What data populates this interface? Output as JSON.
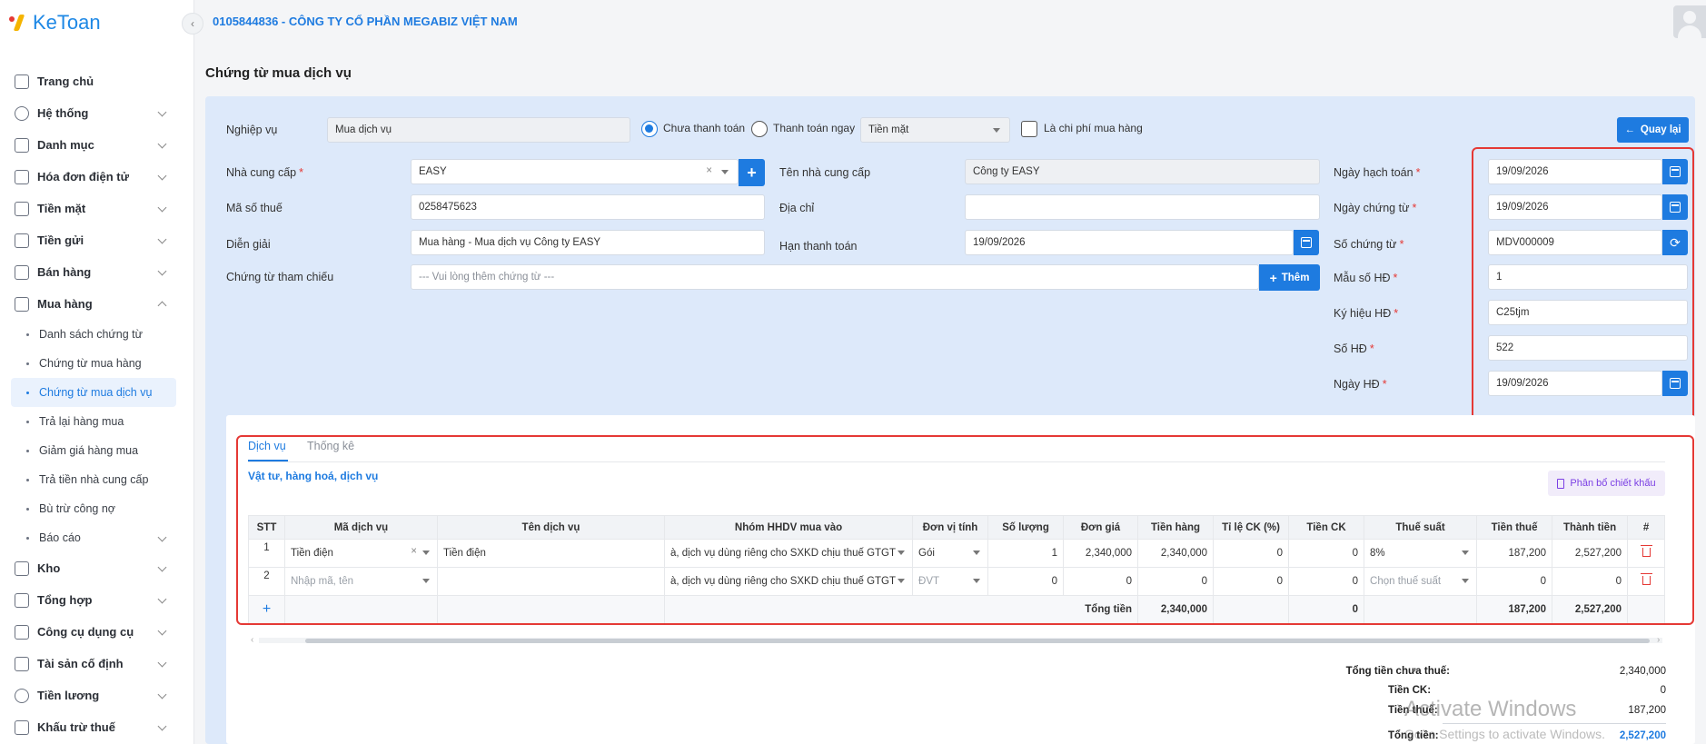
{
  "app": {
    "logo_text": "KeToan",
    "company": "0105844836 - CÔNG TY CỔ PHẦN MEGABIZ VIỆT NAM"
  },
  "sidebar": {
    "items": [
      {
        "label": "Trang chủ",
        "icon": "home-icon"
      },
      {
        "label": "Hệ thống",
        "icon": "gear-icon"
      },
      {
        "label": "Danh mục",
        "icon": "grid-icon"
      },
      {
        "label": "Hóa đơn điện tử",
        "icon": "invoice-icon"
      },
      {
        "label": "Tiền mặt",
        "icon": "cash-icon"
      },
      {
        "label": "Tiền gửi",
        "icon": "bank-card-icon"
      },
      {
        "label": "Bán hàng",
        "icon": "sales-icon"
      },
      {
        "label": "Mua hàng",
        "icon": "purchase-icon"
      }
    ],
    "sub_items": [
      "Danh sách chứng từ",
      "Chứng từ mua hàng",
      "Chứng từ mua dịch vụ",
      "Trả lại hàng mua",
      "Giảm giá hàng mua",
      "Trả tiền nhà cung cấp",
      "Bù trừ công nợ",
      "Báo cáo"
    ],
    "items_after": [
      {
        "label": "Kho",
        "icon": "warehouse-icon"
      },
      {
        "label": "Tổng hợp",
        "icon": "chart-icon"
      },
      {
        "label": "Công cụ dụng cụ",
        "icon": "tools-icon"
      },
      {
        "label": "Tài sản cố định",
        "icon": "car-icon"
      },
      {
        "label": "Tiền lương",
        "icon": "salary-icon"
      },
      {
        "label": "Khấu trừ thuế",
        "icon": "tax-icon"
      }
    ]
  },
  "page": {
    "title": "Chứng từ mua dịch vụ"
  },
  "form": {
    "nghiep_vu_label": "Nghiệp vụ",
    "nghiep_vu_value": "Mua dịch vụ",
    "radio_unpaid": "Chưa thanh toán",
    "radio_paid": "Thanh toán ngay",
    "payment_method": "Tiền mặt",
    "checkbox_label": "Là chi phí mua hàng",
    "back_button": "Quay lại",
    "supplier_label": "Nhà cung cấp",
    "supplier_value": "EASY",
    "supplier_name_label": "Tên nhà cung cấp",
    "supplier_name_value": "Công ty EASY",
    "tax_code_label": "Mã số thuế",
    "tax_code_value": "0258475623",
    "address_label": "Địa chỉ",
    "address_value": "",
    "description_label": "Diễn giải",
    "description_value": "Mua hàng - Mua dịch vụ Công ty EASY",
    "due_date_label": "Hạn thanh toán",
    "due_date_value": "19/09/2026",
    "ref_label": "Chứng từ tham chiếu",
    "ref_placeholder": "--- Vui lòng thêm chứng từ ---",
    "add_button": "Thêm",
    "right": [
      {
        "label": "Ngày hạch toán",
        "value": "19/09/2026",
        "btn": "calendar"
      },
      {
        "label": "Ngày chứng từ",
        "value": "19/09/2026",
        "btn": "calendar"
      },
      {
        "label": "Số chứng từ",
        "value": "MDV000009",
        "btn": "refresh"
      },
      {
        "label": "Mẫu số HĐ",
        "value": "1"
      },
      {
        "label": "Ký hiệu HĐ",
        "value": "C25tjm"
      },
      {
        "label": "Số HĐ",
        "value": "522"
      },
      {
        "label": "Ngày HĐ",
        "value": "19/09/2026",
        "btn": "calendar"
      }
    ],
    "required_mark": "*"
  },
  "detail": {
    "tabs": [
      "Dịch vụ",
      "Thống kê"
    ],
    "section_title": "Vật tư, hàng hoá, dịch vụ",
    "discount_button": "Phân bổ chiết khấu",
    "columns": [
      "STT",
      "Mã dịch vụ",
      "Tên dịch vụ",
      "Nhóm HHDV mua vào",
      "Đơn vị tính",
      "Số lượng",
      "Đơn giá",
      "Tiền hàng",
      "Tỉ lệ CK (%)",
      "Tiền CK",
      "Thuế suất",
      "Tiền thuế",
      "Thành tiền",
      "#"
    ],
    "rows": [
      {
        "stt": "1",
        "ma": "Tiền điện",
        "ten": "Tiền điện",
        "nhom": "à, dịch vụ dùng riêng cho SXKD chịu thuế GTGT",
        "dvt": "Gói",
        "sl": "1",
        "dg": "2,340,000",
        "th": "2,340,000",
        "tl": "0",
        "ck": "0",
        "ts": "8%",
        "tt": "187,200",
        "tien": "2,527,200"
      },
      {
        "stt": "2",
        "ma": "Nhập mã, tên",
        "ten": "",
        "nhom": "à, dịch vụ dùng riêng cho SXKD chịu thuế GTGT",
        "dvt": "ĐVT",
        "sl": "0",
        "dg": "0",
        "th": "0",
        "tl": "0",
        "ck": "0",
        "ts": "Chọn thuế suất",
        "tt": "0",
        "tien": "0"
      }
    ],
    "totals_label": "Tổng tiền",
    "totals": {
      "th": "2,340,000",
      "ck": "0",
      "tt": "187,200",
      "tien": "2,527,200"
    },
    "add_row_symbol": "+"
  },
  "summary": [
    {
      "label": "Tổng tiền chưa thuế:",
      "value": "2,340,000"
    },
    {
      "label": "Tiền CK:",
      "value": "0"
    },
    {
      "label": "Tiền thuế:",
      "value": "187,200"
    },
    {
      "label": "Tổng tiền:",
      "value": "2,527,200"
    }
  ],
  "watermark": {
    "line1": "Activate Windows",
    "line2": "Go to Settings to activate Windows."
  },
  "colors": {
    "accent": "#1e7be0",
    "highlight_border": "#e53935",
    "panel": "#dde9fa"
  }
}
